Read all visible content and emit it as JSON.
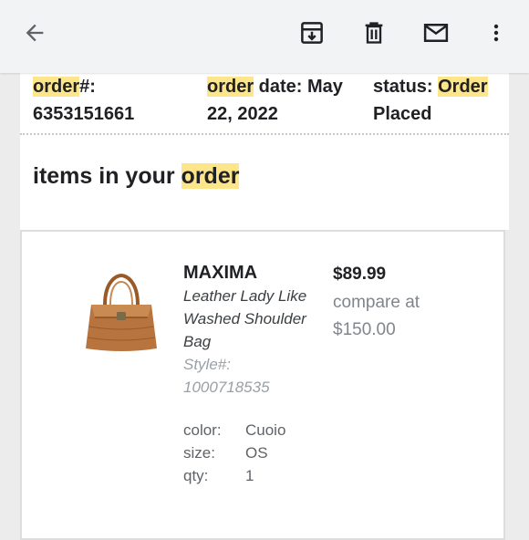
{
  "toolbar": {
    "back_icon": "arrow-left-icon",
    "archive_icon": "archive-icon",
    "delete_icon": "trash-icon",
    "mark_unread_icon": "mail-icon",
    "more_icon": "more-vert-icon"
  },
  "order": {
    "number_label_hl": "order",
    "number_label_rest": "#:",
    "number_value": "6353151661",
    "date_label_hl": "order",
    "date_label_rest": " date: May",
    "date_value": "22, 2022",
    "status_label": "status: ",
    "status_hl": "Order",
    "status_value": "Placed"
  },
  "section": {
    "title_prefix": "items in your ",
    "title_hl": "order"
  },
  "item": {
    "image_icon": "leather-handbag-image",
    "brand": "MAXIMA",
    "description": "Leather Lady Like Washed Shoulder Bag",
    "style": "Style#: 1000718535",
    "price": "$89.99",
    "compare": "compare at $150.00",
    "attributes": [
      {
        "label": "color:",
        "value": "Cuoio"
      },
      {
        "label": "size:",
        "value": "OS"
      },
      {
        "label": "qty:",
        "value": "1"
      }
    ]
  },
  "colors": {
    "highlight": "#fde68a",
    "toolbar_bg": "#f1f3f4",
    "page_bg": "#ececec",
    "bag": "#b8743e"
  }
}
